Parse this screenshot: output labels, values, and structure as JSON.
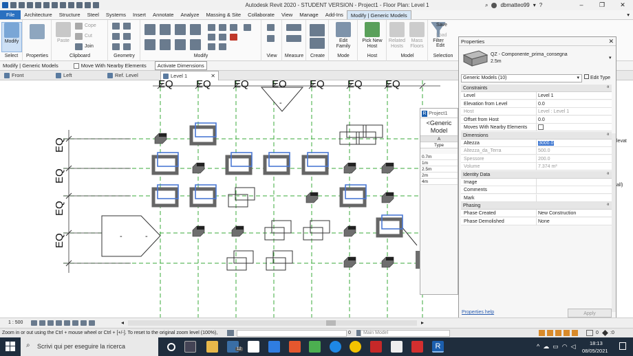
{
  "titlebar": {
    "title": "Autodesk Revit 2020 - STUDENT VERSION - Project1 - Floor Plan: Level 1",
    "username": "dbmatteo99",
    "help_symbol": "?",
    "user_icon": "user-icon"
  },
  "ribbon_tabs": [
    "File",
    "Architecture",
    "Structure",
    "Steel",
    "Systems",
    "Insert",
    "Annotate",
    "Analyze",
    "Massing & Site",
    "Collaborate",
    "View",
    "Manage",
    "Add-Ins",
    "Modify | Generic Models"
  ],
  "ribbon": {
    "modify_label": "Modify",
    "paste_label": "Paste",
    "cope_label": "Cope",
    "cut_label": "Cut",
    "join_label": "Join",
    "edit_family_label": "Edit Family",
    "pick_new_host_label": "Pick New Host",
    "related_hosts_label": "Related Hosts",
    "mass_floors_label": "Mass Floors",
    "filter_label": "Filter",
    "save_label": "Save",
    "load_label": "Load",
    "edit_label": "Edit",
    "panels": [
      "Select",
      "Properties",
      "Clipboard",
      "Geometry",
      "Modify",
      "View",
      "Measure",
      "Create",
      "Mode",
      "Host",
      "Model",
      "Selection"
    ]
  },
  "options_bar": {
    "context": "Modify | Generic Models",
    "checkbox_label": "Move With Nearby Elements",
    "button_label": "Activate Dimensions"
  },
  "view_tabs": [
    "Front",
    "Left",
    "Ref. Level",
    "Level 1"
  ],
  "canvas": {
    "eq_label": "EQ",
    "dash_label": "-"
  },
  "schedule": {
    "tab_title": "Project1",
    "header": "<Generic Model",
    "col_letter": "A",
    "col_name": "Type",
    "rows": [
      "0.7m",
      "1m",
      "2.5m",
      "2m",
      "4m"
    ]
  },
  "properties": {
    "title": "Properties",
    "family_name": "QZ - Componente_prima_consegna",
    "family_type": "2.5m",
    "selector": "Generic Models (10)",
    "edit_type": "Edit Type",
    "categories": {
      "constraints": "Constraints",
      "dimensions": "Dimensions",
      "identity": "Identity Data",
      "phasing": "Phasing"
    },
    "constraints": [
      {
        "k": "Level",
        "v": "Level 1"
      },
      {
        "k": "Elevation from Level",
        "v": "0.0"
      },
      {
        "k": "Host",
        "v": "Level : Level 1"
      },
      {
        "k": "Offset from Host",
        "v": "0.0"
      },
      {
        "k": "Moves With Nearby Elements",
        "v": ""
      }
    ],
    "dimensions": [
      {
        "k": "Altezza",
        "v": "3000.0"
      },
      {
        "k": "Altezza_da_Terra",
        "v": "500.0"
      },
      {
        "k": "Spessore",
        "v": "200.0"
      },
      {
        "k": "Volume",
        "v": "7.374 m³"
      }
    ],
    "identity": [
      {
        "k": "Image",
        "v": ""
      },
      {
        "k": "Comments",
        "v": ""
      },
      {
        "k": "Mark",
        "v": ""
      }
    ],
    "phasing": [
      {
        "k": "Phase Created",
        "v": "New Construction"
      },
      {
        "k": "Phase Demolished",
        "v": "None"
      }
    ],
    "help_link": "Properties help",
    "apply_btn": "Apply",
    "behind_text_1": "levat",
    "behind_text_2": "all)"
  },
  "status": {
    "scale": "1 : 500",
    "hint": "Zoom in or out using the Ctrl + mouse wheel or Ctrl + [+/-]. To reset to the original zoom level (100%),",
    "workset_value": "0",
    "model_select": "Main Model",
    "filter_count": "0",
    "filter_count_full": ":0"
  },
  "taskbar": {
    "search_placeholder": "Scrivi qui per eseguire la ricerca",
    "time": "18:13",
    "date": "08/05/2021",
    "badge": "12"
  },
  "colors": {
    "file_tab": "#2a70c0",
    "taskbar": "#1f2d3d",
    "select_blue": "#4a78d4",
    "grid_green": "#3aa83a"
  }
}
